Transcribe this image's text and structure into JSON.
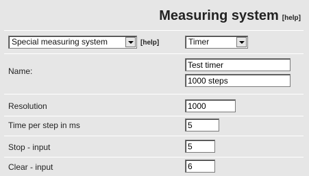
{
  "header": {
    "title": "Measuring system",
    "help": "[help]"
  },
  "system_row": {
    "type_select": "Special measuring system",
    "help": "[help]",
    "kind_select": "Timer"
  },
  "form": {
    "name_label": "Name:",
    "name_value": "Test timer",
    "name_desc": "1000 steps",
    "resolution_label": "Resolution",
    "resolution_value": "1000",
    "time_per_step_label": "Time per step in ms",
    "time_per_step_value": "5",
    "stop_input_label": "Stop - input",
    "stop_input_value": "5",
    "clear_input_label": "Clear - input",
    "clear_input_value": "6"
  }
}
